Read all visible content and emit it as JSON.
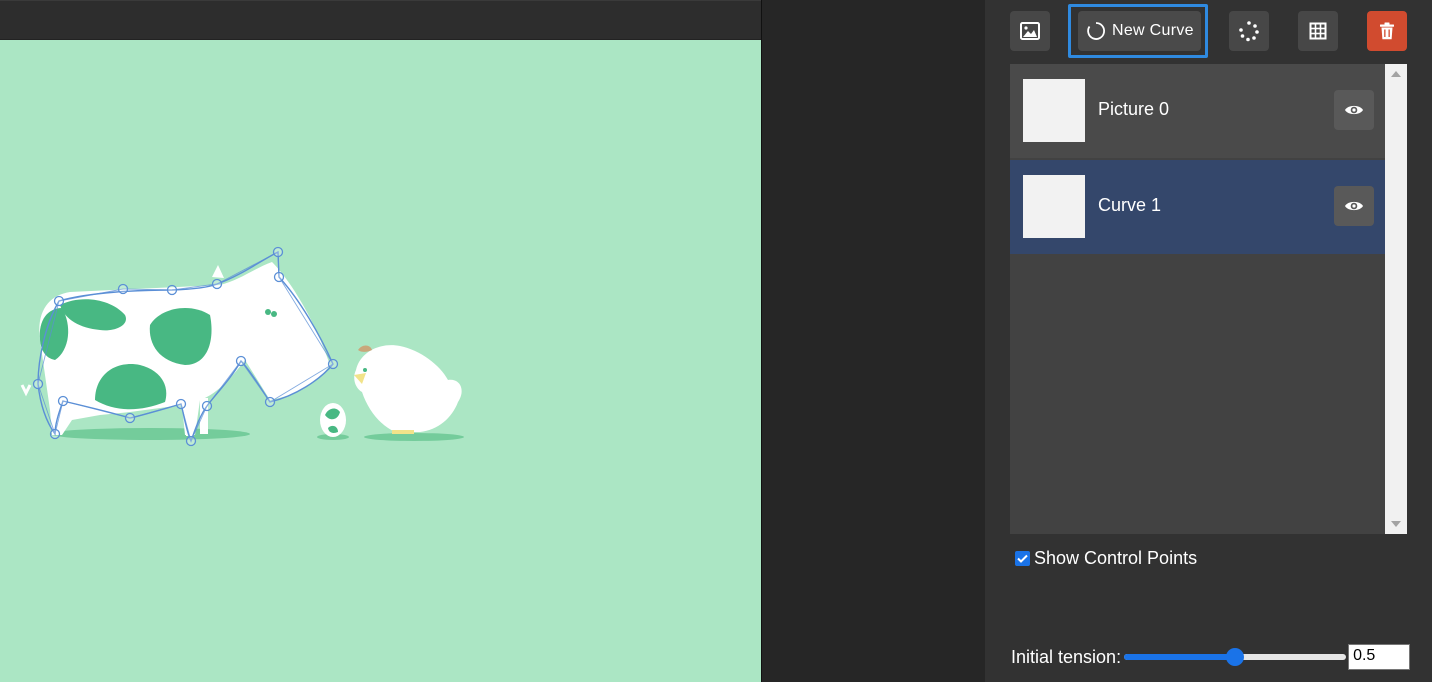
{
  "toolbar": {
    "add_image_icon": "image-icon",
    "new_curve_label": "New Curve",
    "new_curve_icon": "circle-spinner-icon",
    "points_icon": "dotted-circle-icon",
    "grid_icon": "grid-icon",
    "delete_icon": "trash-icon",
    "delete_color": "#d14b2f",
    "highlight_color": "#2f8ae0"
  },
  "layers": [
    {
      "name": "Picture 0",
      "visible_icon": "eye-icon",
      "selected": false
    },
    {
      "name": "Curve 1",
      "visible_icon": "eye-icon",
      "selected": true
    }
  ],
  "options": {
    "show_control_points_label": "Show Control Points",
    "show_control_points_checked": true,
    "initial_tension_label": "Initial tension:",
    "initial_tension_value": "0.5",
    "initial_tension_fraction": 0.5
  },
  "canvas": {
    "background_color": "#abe6c4",
    "curve_color": "#5b8fd6"
  }
}
